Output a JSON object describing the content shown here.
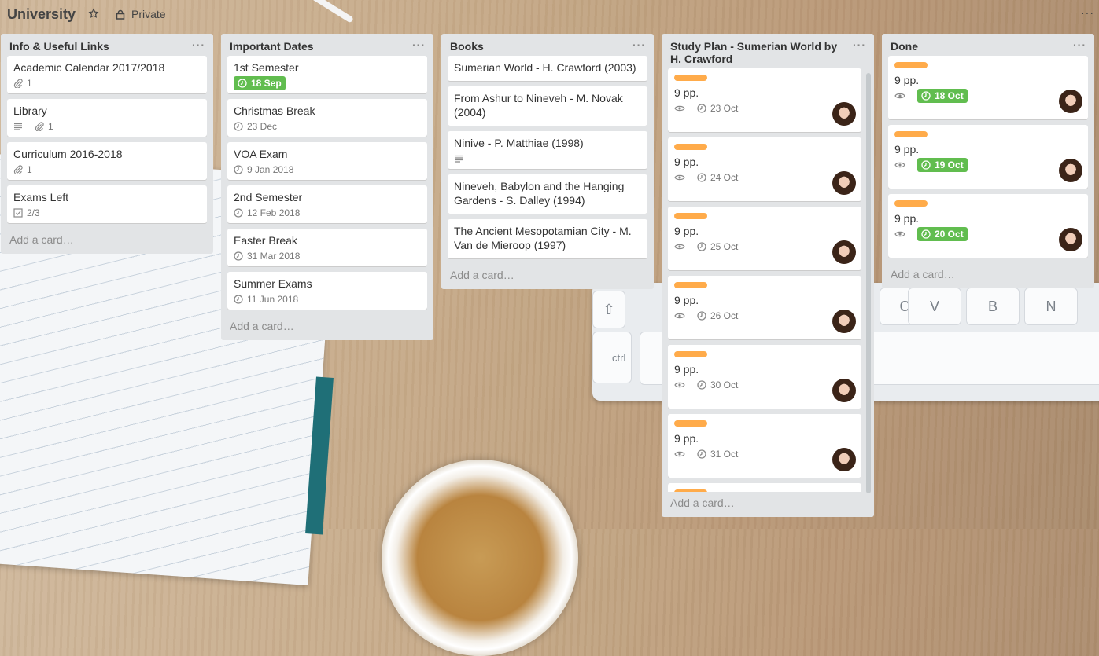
{
  "board": {
    "title": "University",
    "visibility": "Private",
    "menu": "···"
  },
  "lists": [
    {
      "title": "Info & Useful Links",
      "add_card": "Add a card…",
      "cards": [
        {
          "title": "Academic Calendar 2017/2018",
          "attachments": "1"
        },
        {
          "title": "Library",
          "attachments": "1"
        },
        {
          "title": "Curriculum 2016-2018",
          "attachments": "1"
        },
        {
          "title": "Exams Left",
          "checklist": "2/3"
        }
      ]
    },
    {
      "title": "Important Dates",
      "add_card": "Add a card…",
      "cards": [
        {
          "title": "1st Semester",
          "due": "18 Sep"
        },
        {
          "title": "Christmas Break",
          "due": "23 Dec"
        },
        {
          "title": "VOA Exam",
          "due": "9 Jan 2018"
        },
        {
          "title": "2nd Semester",
          "due": "12 Feb 2018"
        },
        {
          "title": "Easter Break",
          "due": "31 Mar 2018"
        },
        {
          "title": "Summer Exams",
          "due": "11 Jun 2018"
        }
      ]
    },
    {
      "title": "Books",
      "add_card": "Add a card…",
      "cards": [
        {
          "title": "Sumerian World - H. Crawford (2003)"
        },
        {
          "title": "From Ashur to Nineveh - M. Novak (2004)"
        },
        {
          "title": "Ninive - P. Matthiae (1998)"
        },
        {
          "title": "Nineveh, Babylon and the Hanging Gardens - S. Dalley (1994)"
        },
        {
          "title": "The Ancient Mesopotamian City - M. Van de Mieroop (1997)"
        }
      ]
    },
    {
      "title": "Study Plan - Sumerian World by H. Crawford",
      "add_card": "Add a card…",
      "cards": [
        {
          "title": "9 pp.",
          "due": "23 Oct"
        },
        {
          "title": "9 pp.",
          "due": "24 Oct"
        },
        {
          "title": "9 pp.",
          "due": "25 Oct"
        },
        {
          "title": "9 pp.",
          "due": "26 Oct"
        },
        {
          "title": "9 pp.",
          "due": "30 Oct"
        },
        {
          "title": "9 pp.",
          "due": "31 Oct"
        }
      ]
    },
    {
      "title": "Done",
      "add_card": "Add a card…",
      "cards": [
        {
          "title": "9 pp.",
          "due": "18 Oct"
        },
        {
          "title": "9 pp.",
          "due": "19 Oct"
        },
        {
          "title": "9 pp.",
          "due": "20 Oct"
        }
      ]
    }
  ],
  "background_keys": [
    "ctrl",
    "C",
    "V",
    "B",
    "N"
  ],
  "colors": {
    "label_orange": "#ffab4a",
    "due_complete_green": "#61bd4f",
    "list_bg": "#e2e4e6"
  }
}
